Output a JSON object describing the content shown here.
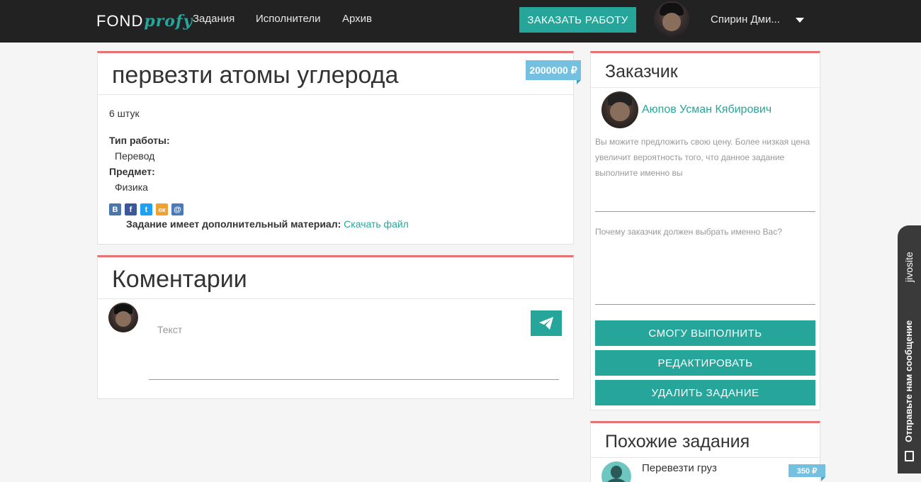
{
  "nav": {
    "logo_part1": "FOND",
    "logo_part2": "profy",
    "links": [
      "Задания",
      "Исполнители",
      "Архив"
    ],
    "order_button": "ЗАКАЗАТЬ РАБОТУ",
    "user_name": "Спирин Дми..."
  },
  "task": {
    "title": "первезти атомы углерода",
    "price": "2000000 ₽",
    "quantity": "6 штук",
    "work_type_label": "Тип работы:",
    "work_type_value": "Перевод",
    "subject_label": "Предмет:",
    "subject_value": "Физика",
    "social": [
      "В",
      "f",
      "t",
      "ок",
      "@"
    ],
    "material_label": "Задание имеет дополнительный материал:",
    "material_link": "Скачать файл"
  },
  "comments": {
    "title": "Коментарии",
    "input_placeholder": "Текст"
  },
  "customer": {
    "title": "Заказчик",
    "name": "Аюпов Усман Кябирович",
    "hint": "Вы можите предложить свою цену. Более низкая цена увеличит вероятность того, что данное задание выполните именно вы",
    "question": "Почему заказчик должен выбрать именно Вас?",
    "buttons": [
      "СМОГУ ВЫПОЛНИТЬ",
      "РЕДАКТИРОВАТЬ",
      "УДАЛИТЬ ЗАДАНИЕ"
    ]
  },
  "similar": {
    "title": "Похожие задания",
    "items": [
      {
        "title": "Перевезти груз",
        "price": "350 ₽"
      }
    ]
  },
  "widget": {
    "brand": "jivosite",
    "message": "Отправьте нам сообщение"
  },
  "colors": {
    "accent": "#26a69a",
    "card_border": "#e57373",
    "price_tag": "#74c0e0",
    "navbar": "#222222"
  }
}
